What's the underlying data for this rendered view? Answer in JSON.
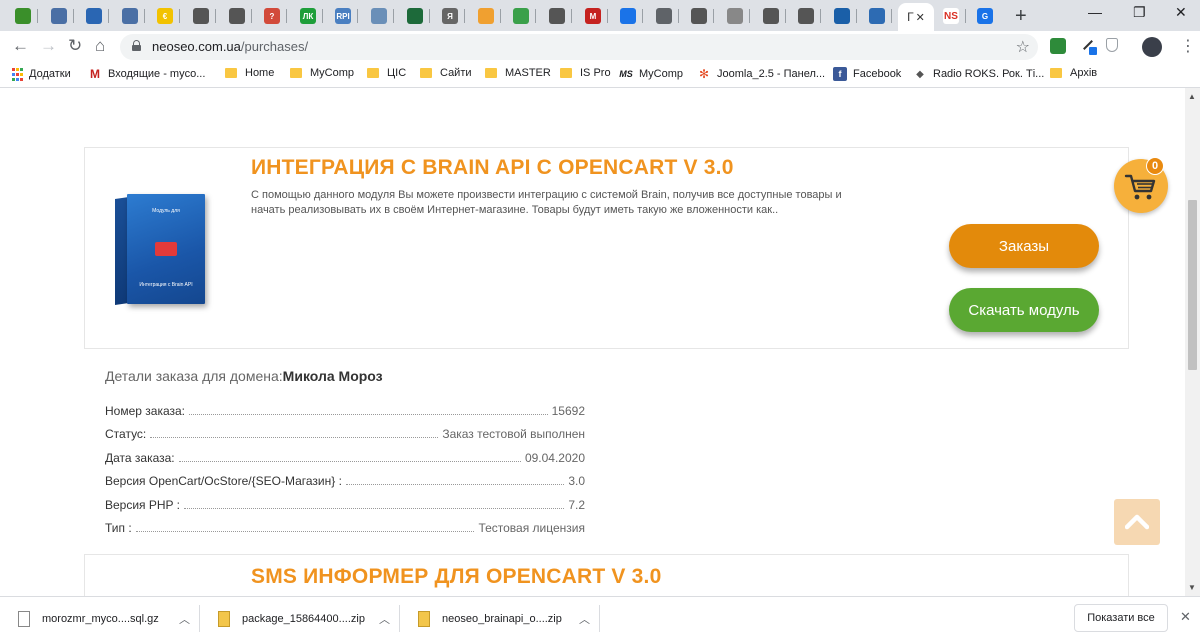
{
  "browser": {
    "active_tab_label": "Г",
    "tab_favicons": [
      {
        "color": "#3a8f2a",
        "glyph": ""
      },
      {
        "color": "#4a6fa5",
        "glyph": ""
      },
      {
        "color": "#2a66b3",
        "glyph": ""
      },
      {
        "color": "#4a6fa5",
        "glyph": ""
      },
      {
        "color": "#f2c200",
        "glyph": "€"
      },
      {
        "color": "#555555",
        "glyph": ""
      },
      {
        "color": "#555555",
        "glyph": ""
      },
      {
        "color": "#d24a3a",
        "glyph": "?"
      },
      {
        "color": "#1e9e3a",
        "glyph": "ЛК"
      },
      {
        "color": "#4a7fc1",
        "glyph": "RPI"
      },
      {
        "color": "#6a8fb8",
        "glyph": ""
      },
      {
        "color": "#1d6a3a",
        "glyph": ""
      },
      {
        "color": "#666666",
        "glyph": "Я"
      },
      {
        "color": "#f0a030",
        "glyph": ""
      },
      {
        "color": "#3aa04a",
        "glyph": ""
      },
      {
        "color": "#555555",
        "glyph": ""
      },
      {
        "color": "#c5221f",
        "glyph": "M"
      },
      {
        "color": "#1a73e8",
        "glyph": ""
      },
      {
        "color": "#5f6368",
        "glyph": ""
      },
      {
        "color": "#555555",
        "glyph": ""
      },
      {
        "color": "#888888",
        "glyph": ""
      },
      {
        "color": "#555555",
        "glyph": ""
      },
      {
        "color": "#555555",
        "glyph": ""
      },
      {
        "color": "#1a5fa8",
        "glyph": ""
      },
      {
        "color": "#2d6bb3",
        "glyph": ""
      }
    ],
    "extra_tabs": [
      {
        "label": "NS",
        "color": "#d93025"
      },
      {
        "label": "G",
        "color": "#1a73e8"
      }
    ],
    "url_host": "neoseo.com.ua",
    "url_path": "/purchases/"
  },
  "bookmarks": [
    {
      "label": "Додатки",
      "type": "apps"
    },
    {
      "label": "Входящие - myco...",
      "type": "gmail"
    },
    {
      "label": "Home",
      "type": "folder"
    },
    {
      "label": "MyComp",
      "type": "folder"
    },
    {
      "label": "ЦІС",
      "type": "folder"
    },
    {
      "label": "Сайти",
      "type": "folder"
    },
    {
      "label": "MASTER",
      "type": "folder"
    },
    {
      "label": "IS Pro",
      "type": "folder"
    },
    {
      "label": "MyComp",
      "type": "ms"
    },
    {
      "label": "Joomla_2.5 - Панел...",
      "type": "joomla"
    },
    {
      "label": "Facebook",
      "type": "facebook"
    },
    {
      "label": "Radio ROKS. Рок. Ті...",
      "type": "radio"
    },
    {
      "label": "Архів",
      "type": "folder"
    }
  ],
  "product1": {
    "title": "ИНТЕГРАЦИЯ С BRAIN API С OPENCART V 3.0",
    "description": "С помощью данного модуля Вы можете произвести интеграцию с системой Brain, получив все доступные товары и начать реализовывать их в своём Интернет-магазине. Товары будут иметь такую же вложенности как..",
    "orders_button": "Заказы",
    "download_button": "Скачать модуль"
  },
  "cart": {
    "count": "0"
  },
  "details": {
    "heading": "Детали заказа для домена:",
    "domain_name": "Микола Мороз",
    "rows": [
      {
        "key": "Номер заказа:",
        "value": "15692"
      },
      {
        "key": "Статус:",
        "value": "Заказ тестовой выполнен"
      },
      {
        "key": "Дата заказа:",
        "value": "09.04.2020"
      },
      {
        "key": "Версия OpenCart/OcStore/{SEO-Магазин} :",
        "value": "3.0"
      },
      {
        "key": "Версия PHP :",
        "value": "7.2"
      },
      {
        "key": "Тип :",
        "value": "Тестовая лицензия"
      }
    ]
  },
  "product2": {
    "title": "SMS ИНФОРМЕР ДЛЯ OPENCART V 3.0"
  },
  "downloads": {
    "items": [
      {
        "name": "morozmr_myco....sql.gz",
        "kind": "file"
      },
      {
        "name": "package_15864400....zip",
        "kind": "zip"
      },
      {
        "name": "neoseo_brainapi_o....zip",
        "kind": "zip"
      }
    ],
    "show_all": "Показати все"
  }
}
